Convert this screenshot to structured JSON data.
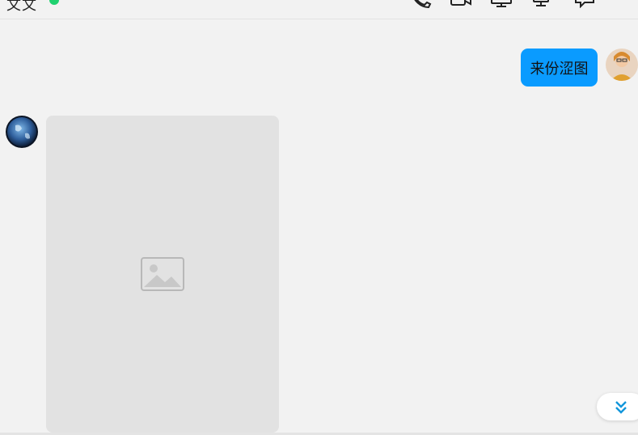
{
  "header": {
    "contact_name": "文文",
    "online": true,
    "actions": [
      {
        "name": "voice-call",
        "icon": "phone-icon"
      },
      {
        "name": "video-call",
        "icon": "video-camera-icon"
      },
      {
        "name": "screen-share",
        "icon": "monitor-icon"
      },
      {
        "name": "remote-control",
        "icon": "remote-desktop-icon"
      },
      {
        "name": "chat-bubble",
        "icon": "chat-bubble-icon"
      }
    ]
  },
  "messages": [
    {
      "direction": "outgoing",
      "type": "text",
      "text": "来份涩图",
      "avatar": "user-avatar"
    },
    {
      "direction": "incoming",
      "type": "image",
      "avatar": "contact-avatar"
    }
  ],
  "colors": {
    "background": "#f2f2f2",
    "outgoing_bubble": "#0a9bff",
    "online": "#1fd16f",
    "scroll_arrow": "#1296db"
  },
  "scroll_to_bottom": {
    "icon": "double-chevron-down-icon"
  }
}
